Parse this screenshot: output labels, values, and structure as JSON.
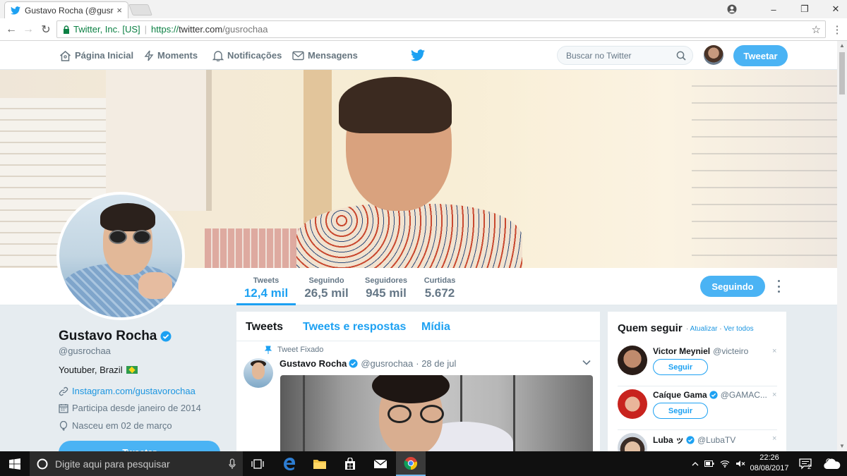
{
  "browser": {
    "tab_title": "Gustavo Rocha (@gusro",
    "security_label": "Twitter, Inc. [US]",
    "url_scheme": "https://",
    "url_host": "twitter.com",
    "url_path": "/gusrochaa"
  },
  "topnav": {
    "home": "Página Inicial",
    "moments": "Moments",
    "notifications": "Notificações",
    "messages": "Mensagens",
    "search_placeholder": "Buscar no Twitter",
    "tweet_button": "Tweetar"
  },
  "profile": {
    "name": "Gustavo Rocha",
    "handle": "@gusrochaa",
    "bio": "Youtuber, Brazil",
    "link": "Instagram.com/gustavorochaa",
    "joined": "Participa desde janeiro de 2014",
    "birthday": "Nasceu em 02 de março",
    "sidebar_tweet_button": "Tweetar"
  },
  "stats": [
    {
      "label": "Tweets",
      "value": "12,4 mil"
    },
    {
      "label": "Seguindo",
      "value": "26,5 mil"
    },
    {
      "label": "Seguidores",
      "value": "945 mil"
    },
    {
      "label": "Curtidas",
      "value": "5.672"
    }
  ],
  "following_button": "Seguindo",
  "timeline": {
    "tabs": [
      "Tweets",
      "Tweets e respostas",
      "Mídia"
    ],
    "pinned_label": "Tweet Fixado",
    "tweet": {
      "name": "Gustavo Rocha",
      "handle": "@gusrochaa",
      "date": "· 28 de jul"
    }
  },
  "who_to_follow": {
    "title": "Quem seguir",
    "dot": "·",
    "refresh": "Atualizar",
    "view_all": "Ver todos",
    "follow_label": "Seguir",
    "close": "×",
    "items": [
      {
        "name": "Victor Meyniel",
        "handle": "@victeiro"
      },
      {
        "name": "Caíque Gama",
        "handle": "@GAMAC..."
      },
      {
        "name": "Luba ッ",
        "handle": "@LubaTV"
      }
    ]
  },
  "taskbar": {
    "search_placeholder": "Digite aqui para pesquisar",
    "time": "22:26",
    "date": "08/08/2017",
    "notifications_count": "2"
  },
  "colors": {
    "twitter_blue": "#1da1f2",
    "button_blue": "#4ab3f4",
    "taskbar": "#101010"
  }
}
